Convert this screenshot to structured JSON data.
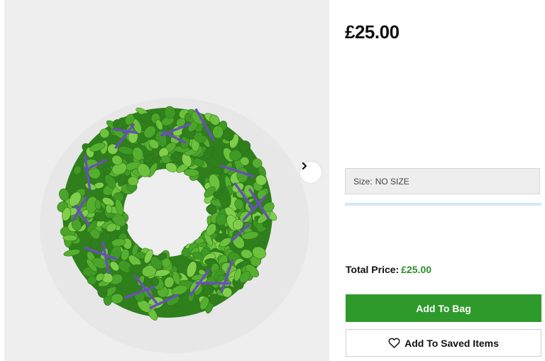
{
  "product": {
    "image_alt": "Green boxwood wreath with lavender sprigs",
    "price": "£25.00"
  },
  "size": {
    "label": "Size:",
    "value": "NO SIZE"
  },
  "total": {
    "label": "Total Price:",
    "value": "£25.00"
  },
  "actions": {
    "add_to_bag": "Add To Bag",
    "add_to_saved": "Add To Saved Items"
  },
  "icons": {
    "next": "chevron-right-icon",
    "saved": "heart-icon"
  },
  "colors": {
    "gallery_bg": "#eeeeee",
    "primary_button": "#2f9a2c",
    "total_value": "#2e8b2e",
    "wreath_green": "#3f9a25",
    "lavender": "#6a4fb8"
  }
}
